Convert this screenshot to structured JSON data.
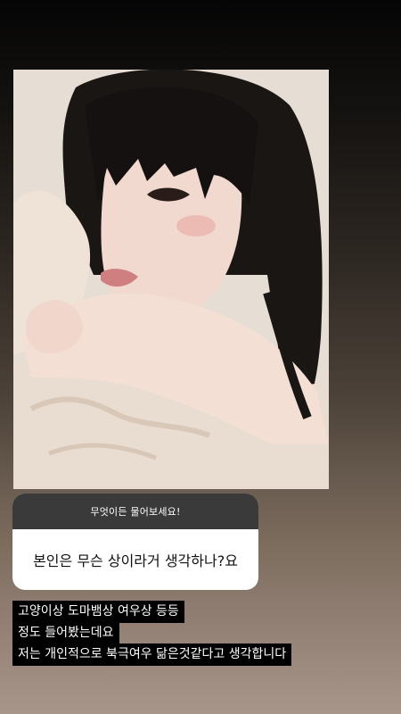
{
  "question_box": {
    "prompt": "무엇이든 물어보세요!",
    "question": "본인은 무슨 상이라거 생각하나?요"
  },
  "caption": {
    "lines": [
      "고양이상 도마뱀상 여우상 등등",
      "정도 들어봤는데요",
      "저는 개인적으로 북극여우 닮은것같다고 생각합니다"
    ]
  },
  "colors": {
    "question_header": "#3a3a3a",
    "caption_bg": "#000000"
  }
}
